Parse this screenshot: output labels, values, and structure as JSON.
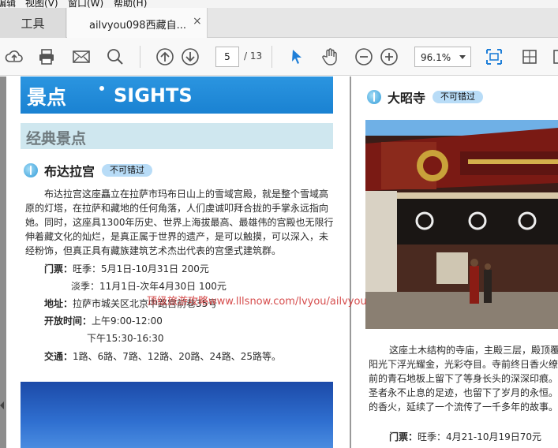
{
  "menubar": {
    "items": [
      "编辑",
      "视图(V)",
      "窗口(W)",
      "帮助(H)"
    ]
  },
  "tabs": {
    "tools": "工具",
    "document": "ailvyou098西藏自...",
    "close": "×"
  },
  "toolbar": {
    "page_current": "5",
    "page_total": "/ 13",
    "zoom": "96.1%"
  },
  "page1": {
    "banner_cn": "景点",
    "banner_en": "SIGHTS",
    "subheader": "经典景点",
    "section_title": "布达拉宫",
    "badge": "不可错过",
    "paragraph": [
      "布达拉宫这座矗立在拉萨市玛布日山上的雪域宫殿，就是整个雪域高",
      "原的灯塔，在拉萨和藏地的任何角落，人们虔诚叩拜合拢的手掌永远指向",
      "她。同时，这座具1300年历史、世界上海拔最高、最雄伟的宫殿也无限行",
      "伸着藏文化的灿烂，是真正属于世界的遗产，是可以触摸，可以深入，未",
      "经粉饰，但真正具有藏族建筑艺术杰出代表的宫堡式建筑群。"
    ],
    "ticket_label": "门票：",
    "ticket_peak": "旺季：5月1日-10月31日 200元",
    "ticket_low": "淡季：11月1日-次年4月30日 100元",
    "address_label": "地址：",
    "address": "拉萨市城关区北京中路宫前巷35号",
    "hours_label": "开放时间：",
    "hours_am": "上午9:00-12:00",
    "hours_pm": "下午15:30-16:30",
    "transport_label": "交通：",
    "transport": "1路、6路、7路、12路、20路、24路、25路等。",
    "watermark": "顶级旅游攻略www.lllsnow.com/lvyou/ailvyou"
  },
  "page2": {
    "section_title": "大昭寺",
    "badge": "不可错过",
    "paragraph": [
      "这座土木结构的寺庙，主殿三层，殿顶覆",
      "阳光下浮光耀金，光彩夺目。寺前终日香火缭",
      "前的青石地板上留下了等身长头的深深印痕。",
      "圣者永不止息的足迹，也留下了岁月的永恒。",
      "的香火，延续了一个流传了一千多年的故事。"
    ],
    "ticket_label": "门票：",
    "ticket": "旺季：4月21-10月19日70元"
  },
  "colors": {
    "banner": "#1a82d2",
    "subheader_bg": "#cfe7ef",
    "badge_bg": "#b8dcf7",
    "toolbar_blue": "#1f7fd8"
  }
}
